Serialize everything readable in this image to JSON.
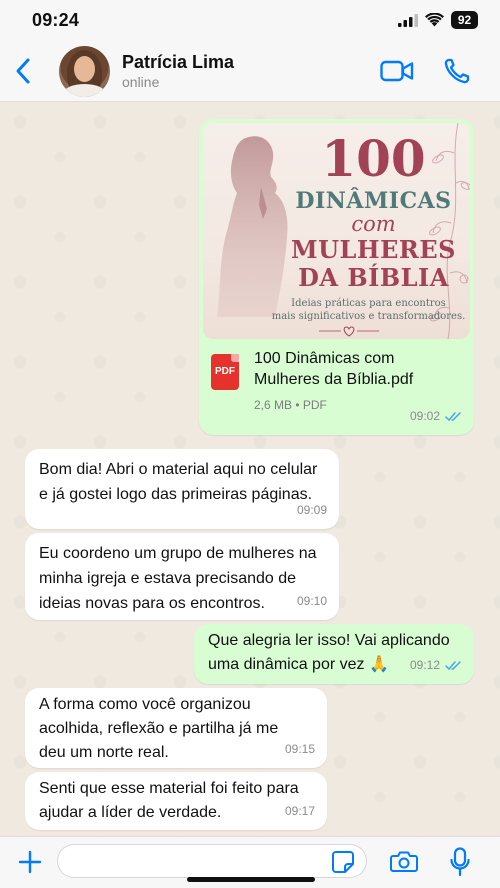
{
  "status_bar": {
    "time": "09:24",
    "battery": "92",
    "icons": [
      "signal-icon",
      "wifi-icon",
      "battery-icon"
    ]
  },
  "header": {
    "contact_name": "Patrícia Lima",
    "contact_status": "online",
    "icons": [
      "back-chevron-icon",
      "video-call-icon",
      "phone-icon"
    ],
    "accent_color": "#007aff"
  },
  "messages": [
    {
      "direction": "out",
      "type": "document",
      "cover": {
        "number": "100",
        "line1": "DINÂMICAS",
        "line2": "com",
        "line3": "MULHERES",
        "line4": "DA BÍBLIA",
        "tagline": "Ideias práticas para encontros\nmais significativos e transformadores."
      },
      "file_type_label": "PDF",
      "file_name": "100 Dinâmicas com\nMulheres da Bíblia.pdf",
      "file_details": "2,6 MB • PDF",
      "time": "09:02",
      "read": true
    },
    {
      "direction": "in",
      "text": "Bom dia! Abri o material aqui no celular\ne já gostei logo das primeiras páginas.",
      "time": "09:09"
    },
    {
      "direction": "in",
      "text": "Eu coordeno um grupo de mulheres na\nminha igreja e estava precisando de\nideias novas para os encontros.",
      "time": "09:10"
    },
    {
      "direction": "out",
      "text": "Que alegria ler isso! Vai aplicando\numa dinâmica por vez 🙏",
      "time": "09:12",
      "read": true
    },
    {
      "direction": "in",
      "text": "A forma como você organizou\nacolhida, reflexão e partilha já me\ndeu um norte real.",
      "time": "09:15"
    },
    {
      "direction": "in",
      "text": "Senti que esse material foi feito para\najudar a líder de verdade.",
      "time": "09:17"
    }
  ],
  "input_bar": {
    "placeholder": "",
    "icons": [
      "plus-icon",
      "sticker-icon",
      "camera-icon",
      "microphone-icon"
    ]
  },
  "colors": {
    "outgoing_bubble": "#d8fdd2",
    "incoming_bubble": "#ffffff",
    "read_ticks": "#4aa6e8",
    "cover_title": "#a24257",
    "cover_teal": "#4f7a78"
  }
}
